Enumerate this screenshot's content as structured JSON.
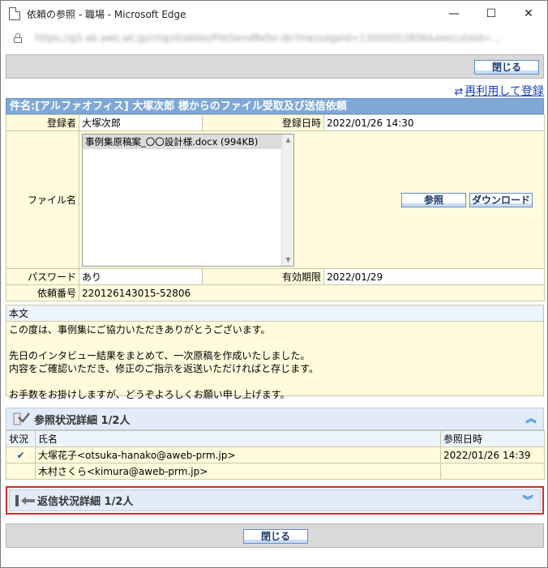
{
  "window": {
    "title": "依頼の参照 - 職場 - Microsoft Edge",
    "url": "https://g3.ab.aws.wt.jp/cmp/d/ables/FileSendRefer.do?messageId=13000052806&executeId=..."
  },
  "toolbar": {
    "close_label": "閉じる",
    "reuse_label": "再利用して登録"
  },
  "request": {
    "subject": "件名:[アルファオフィス] 大塚次郎 様からのファイル受取及び送信依頼",
    "registrant_label": "登録者",
    "registrant": "大塚次郎",
    "registered_at_label": "登録日時",
    "registered_at": "2022/01/26 14:30",
    "file_label": "ファイル名",
    "files": [
      "事例集原稿案_〇〇設計様.docx (994KB)"
    ],
    "browse_label": "参照",
    "download_label": "ダウンロード",
    "password_label": "パスワード",
    "password": "あり",
    "expiry_label": "有効期限",
    "expiry": "2022/01/29",
    "request_no_label": "依頼番号",
    "request_no": "220126143015-52806"
  },
  "body": {
    "heading": "本文",
    "lines": [
      "この度は、事例集にご協力いただきありがとうございます。",
      "",
      "先日のインタビュー結果をまとめて、一次原稿を作成いたしました。",
      "内容をご確認いただき、修正のご指示を返送いただければと存じます。",
      "",
      "お手数をお掛けしますが、どうぞよろしくお願い申し上げます。"
    ]
  },
  "reference_status": {
    "title": "参照状況詳細 1/2人",
    "columns": [
      "状況",
      "氏名",
      "参照日時"
    ],
    "rows": [
      {
        "status": "checked",
        "name": "大塚花子<otsuka-hanako@aweb-prm.jp>",
        "date": "2022/01/26 14:39"
      },
      {
        "status": "",
        "name": "木村さくら<kimura@aweb-prm.jp>",
        "date": ""
      }
    ]
  },
  "reply_status": {
    "title": "返信状況詳細 1/2人"
  }
}
